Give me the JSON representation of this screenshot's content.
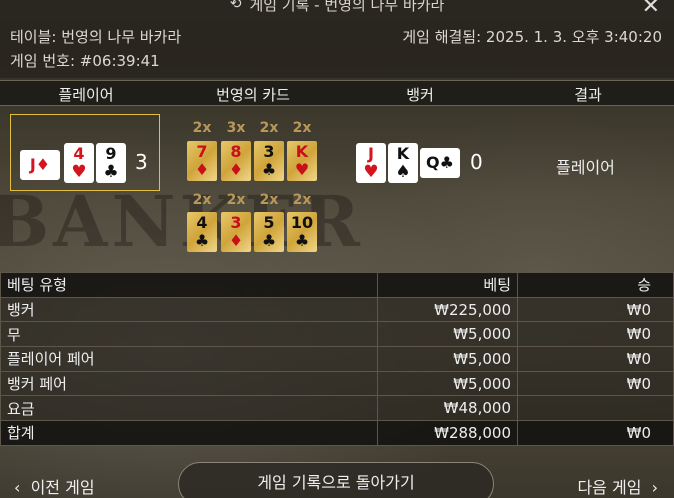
{
  "window": {
    "title": "게임 기록 - 번영의 나무 바카라"
  },
  "info": {
    "table": "테이블: 번영의 나무 바카라",
    "game_number": "게임 번호: #06:39:41",
    "resolved": "게임 해결됨: 2025. 1. 3. 오후 3:40:20"
  },
  "columns": {
    "player": "플레이어",
    "prosperity_cards": "번영의 카드",
    "banker": "뱅커",
    "result": "결과"
  },
  "player": {
    "cards": [
      {
        "rank": "J",
        "suit": "♦",
        "color": "red",
        "orientation": "side"
      },
      {
        "rank": "4",
        "suit": "♥",
        "color": "red"
      },
      {
        "rank": "9",
        "suit": "♣",
        "color": "black"
      }
    ],
    "score": "3"
  },
  "banker": {
    "cards": [
      {
        "rank": "J",
        "suit": "♥",
        "color": "red"
      },
      {
        "rank": "K",
        "suit": "♠",
        "color": "black"
      },
      {
        "rank": "Q",
        "suit": "♣",
        "color": "black",
        "orientation": "side"
      }
    ],
    "score": "0"
  },
  "prosperity": {
    "row1": [
      {
        "mult": "2x",
        "rank": "7",
        "suit": "♦",
        "color": "red"
      },
      {
        "mult": "3x",
        "rank": "8",
        "suit": "♦",
        "color": "red"
      },
      {
        "mult": "2x",
        "rank": "3",
        "suit": "♣",
        "color": "black"
      },
      {
        "mult": "2x",
        "rank": "K",
        "suit": "♥",
        "color": "red"
      }
    ],
    "row2": [
      {
        "mult": "2x",
        "rank": "4",
        "suit": "♣",
        "color": "black"
      },
      {
        "mult": "2x",
        "rank": "3",
        "suit": "♦",
        "color": "red"
      },
      {
        "mult": "2x",
        "rank": "5",
        "suit": "♣",
        "color": "black"
      },
      {
        "mult": "2x",
        "rank": "10",
        "suit": "♣",
        "color": "black"
      }
    ]
  },
  "result": "플레이어",
  "bets": {
    "header": {
      "type": "베팅 유형",
      "bet": "베팅",
      "win": "승"
    },
    "rows": [
      {
        "type": "뱅커",
        "bet": "₩225,000",
        "win": "₩0"
      },
      {
        "type": "무",
        "bet": "₩5,000",
        "win": "₩0"
      },
      {
        "type": "플레이어 페어",
        "bet": "₩5,000",
        "win": "₩0"
      },
      {
        "type": "뱅커 페어",
        "bet": "₩5,000",
        "win": "₩0"
      },
      {
        "type": "요금",
        "bet": "₩48,000",
        "win": ""
      }
    ],
    "total": {
      "type": "합계",
      "bet": "₩288,000",
      "win": "₩0"
    }
  },
  "background_text": "BANKER",
  "footer": {
    "prev": "이전 게임",
    "back": "게임 기록으로 돌아가기",
    "next": "다음 게임"
  },
  "icons": {
    "history": "history-icon",
    "close": "close-icon",
    "prev": "chevron-left-icon",
    "next": "chevron-right-icon"
  },
  "colors": {
    "highlight": "#e2c03d",
    "red_suit": "#d4141f",
    "gold_card": "#cfa43a"
  }
}
